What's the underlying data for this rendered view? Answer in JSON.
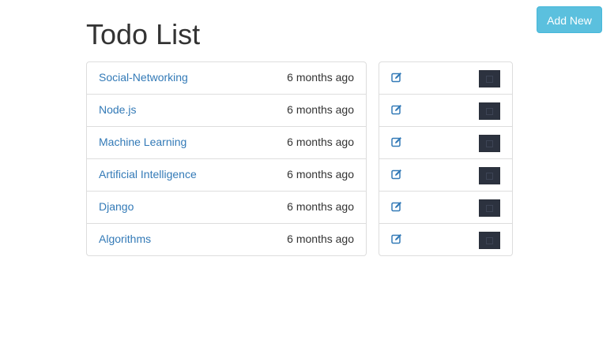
{
  "header": {
    "title": "Todo List",
    "add_new_label": "Add New"
  },
  "colors": {
    "link": "#337ab7",
    "info_button": "#5bc0de",
    "delete_button": "#2c323f",
    "border": "#dddddd"
  },
  "icons": {
    "edit": "edit-icon",
    "delete": "trash-icon"
  },
  "todos": [
    {
      "title": "Social-Networking",
      "time": "6 months ago"
    },
    {
      "title": "Node.js",
      "time": "6 months ago"
    },
    {
      "title": "Machine Learning",
      "time": "6 months ago"
    },
    {
      "title": "Artificial Intelligence",
      "time": "6 months ago"
    },
    {
      "title": "Django",
      "time": "6 months ago"
    },
    {
      "title": "Algorithms",
      "time": "6 months ago"
    }
  ]
}
